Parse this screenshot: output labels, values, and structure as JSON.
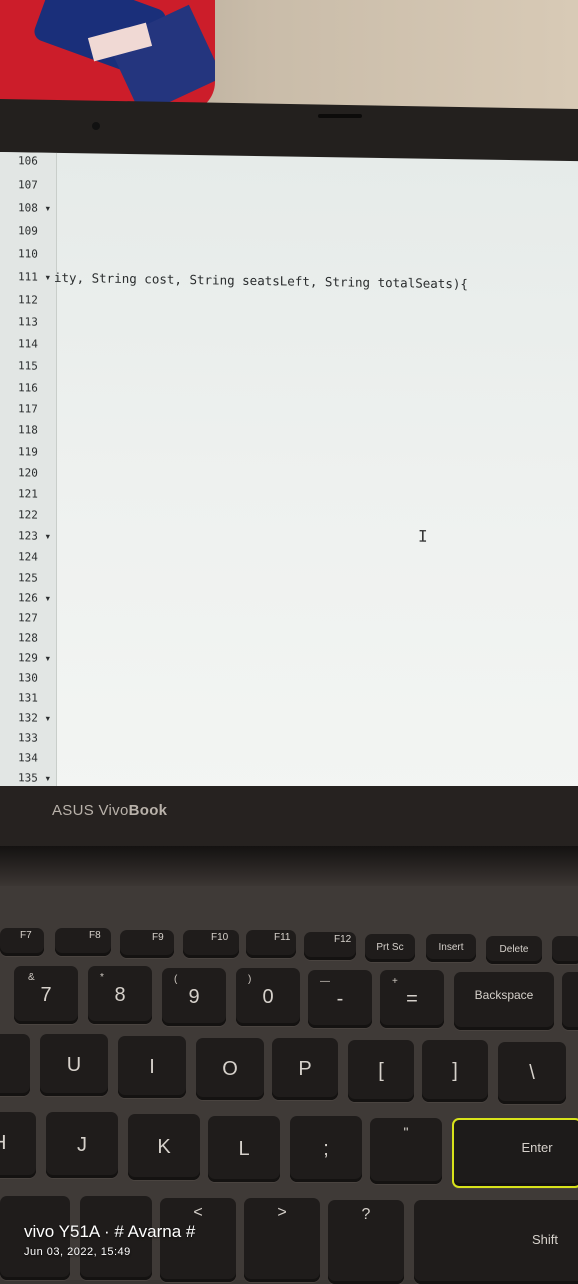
{
  "editor": {
    "line_numbers": [
      "106",
      "107",
      "108 ▾",
      "109",
      "110",
      "111 ▾",
      "112",
      "113",
      "114",
      "115",
      "116",
      "117",
      "118",
      "119",
      "120",
      "121",
      "122",
      "123 ▾",
      "124",
      "125",
      "126 ▾",
      "127",
      "128",
      "129 ▾",
      "130",
      "131",
      "132 ▾",
      "133",
      "134",
      "135 ▾"
    ],
    "code_line": "ity, String cost, String seatsLeft, String totalSeats){",
    "cursor_glyph": "I"
  },
  "laptop": {
    "brand_prefix": "ASUS Vivo",
    "brand_suffix": "Book"
  },
  "keyboard": {
    "fn_row": [
      "F7",
      "F8",
      "F9",
      "F10",
      "F11",
      "F12",
      "Prt Sc",
      "Insert",
      "Delete"
    ],
    "number_row": [
      {
        "main": "7",
        "sub": "&"
      },
      {
        "main": "8",
        "sub": "*"
      },
      {
        "main": "9",
        "sub": "("
      },
      {
        "main": "0",
        "sub": ")"
      },
      {
        "main": "-",
        "sub": "—"
      },
      {
        "main": "=",
        "sub": "+"
      },
      {
        "main": "Backspace",
        "sub": ""
      }
    ],
    "top_row": [
      "U",
      "I",
      "O",
      "P",
      "[",
      "]",
      "\\"
    ],
    "home_row": [
      "H",
      "J",
      "K",
      "L",
      ";",
      "\"",
      "Enter"
    ],
    "bottom_row": [
      "<",
      ">",
      "?",
      "Shift"
    ]
  },
  "photo_watermark": {
    "device": "vivo Y51A",
    "tag": "· # Avarna #",
    "timestamp": "Jun 03, 2022, 15:49"
  }
}
